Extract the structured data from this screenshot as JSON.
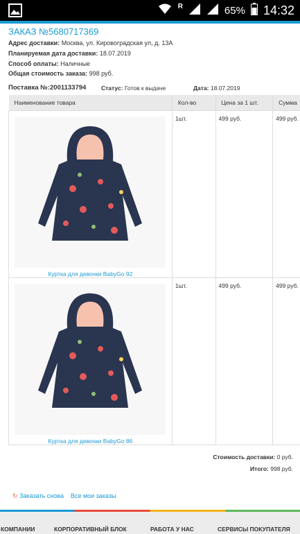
{
  "status_bar": {
    "battery_percent": "65%",
    "time": "14:32",
    "roaming": "R",
    "icons": [
      "gallery-icon",
      "wifi-icon",
      "signal-icon",
      "battery-icon"
    ]
  },
  "order": {
    "title": "ЗАКАЗ №5680717369",
    "address_label": "Адрес доставки:",
    "address_value": "Москва, ул. Кировоградская ул, д. 13А",
    "date_label": "Планируемая дата доставки:",
    "date_value": "18.07.2019",
    "payment_label": "Способ оплаты:",
    "payment_value": "Наличные",
    "total_label": "Общая стоимость заказа:",
    "total_value": "998 руб."
  },
  "shipment": {
    "number_label": "Поставка №:",
    "number_value": "2001133794",
    "status_label": "Статус:",
    "status_value": "Готов к выдаче",
    "date_label": "Дата:",
    "date_value": "18.07.2019"
  },
  "table": {
    "headers": [
      "Наименование товара",
      "Кол-во",
      "Цена за 1 шт.",
      "Сумма"
    ],
    "rows": [
      {
        "name": "Куртка для девочки BabyGo 92",
        "qty": "1шт.",
        "price": "499 руб.",
        "sum": "499 руб."
      },
      {
        "name": "Куртка для девочки BabyGo 86",
        "qty": "1шт.",
        "price": "499 руб.",
        "sum": "499 руб."
      }
    ]
  },
  "totals": {
    "delivery_label": "Стоимость доставки:",
    "delivery_value": "0 руб.",
    "total_label": "Итого:",
    "total_value": "998 руб."
  },
  "actions": {
    "reorder": "Заказать снова",
    "all_orders": "Все мои заказы"
  },
  "footer": {
    "items": [
      "О КОМПАНИИ",
      "КОРПОРАТИВНЫЙ БЛОК",
      "РАБОТА У НАС",
      "СЕРВИСЫ ПОКУПАТЕЛЯ"
    ]
  },
  "colors": {
    "accent": "#1a9ad6",
    "jacket": "#2a3550",
    "lining": "#f6c2ae"
  }
}
